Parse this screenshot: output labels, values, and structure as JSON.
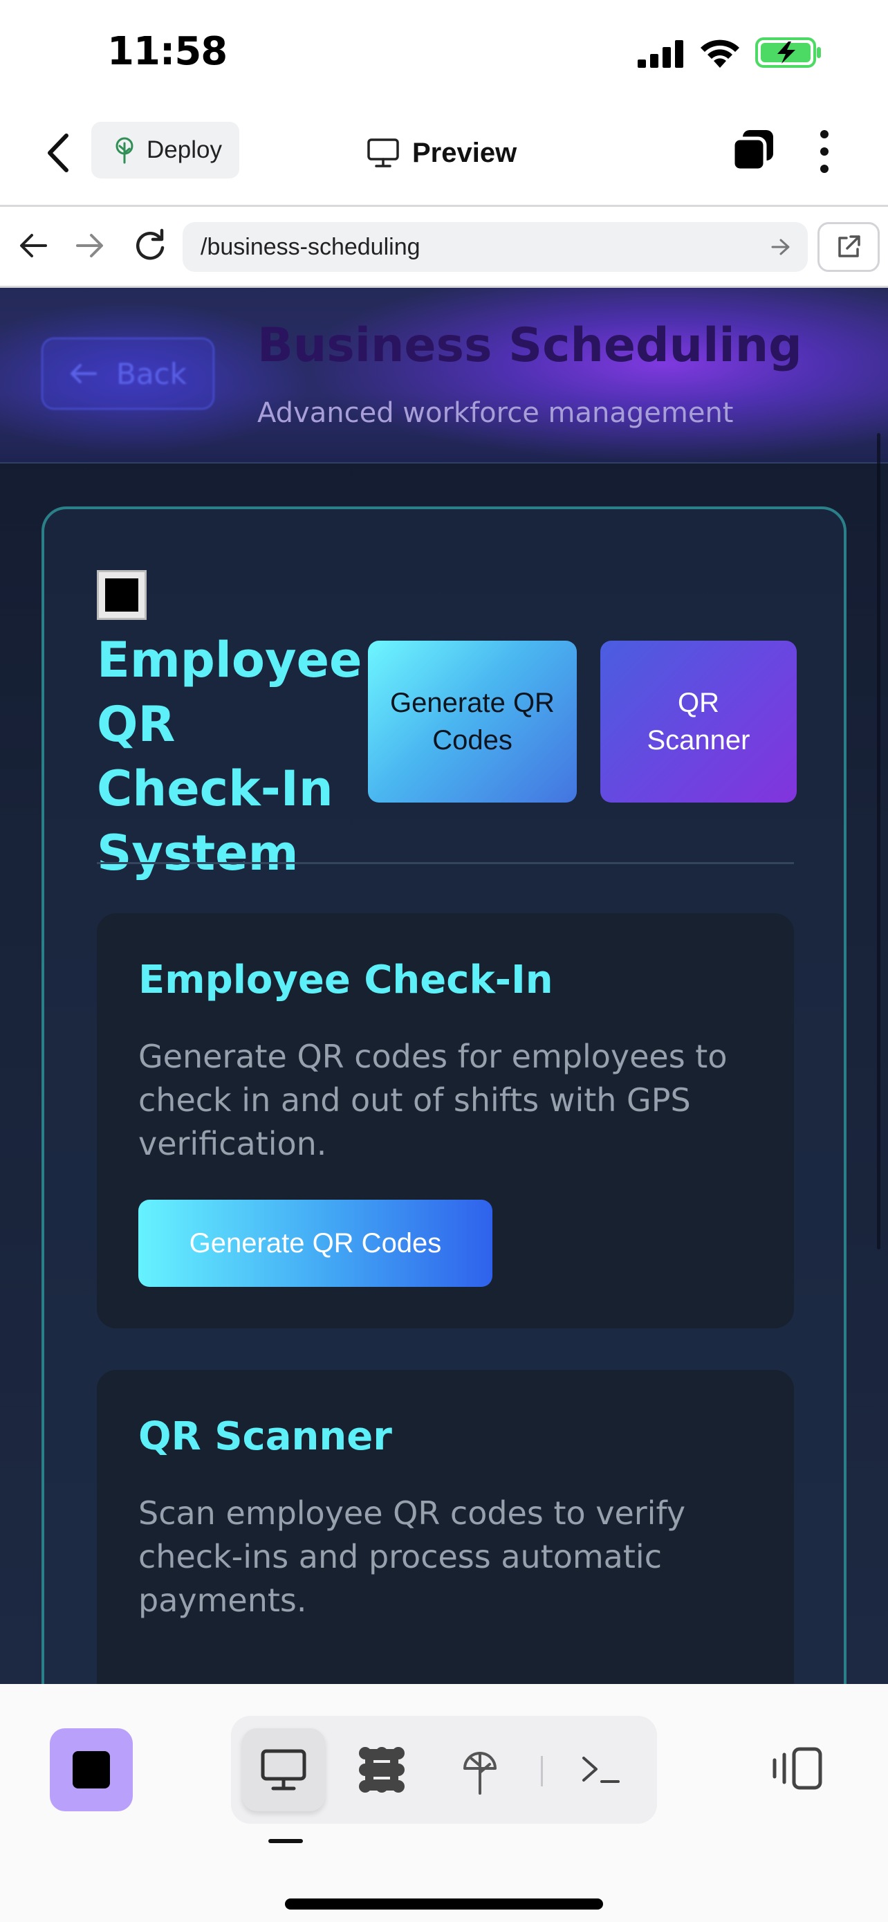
{
  "status_bar": {
    "time": "11:58"
  },
  "app_header": {
    "deploy_label": "Deploy",
    "title": "Preview"
  },
  "browser": {
    "url": "/business-scheduling"
  },
  "page": {
    "hero": {
      "back_label": "Back",
      "title": "Business Scheduling",
      "subtitle": "Advanced workforce management"
    },
    "card": {
      "title": "Employee QR Check-In System",
      "generate_button": "Generate QR Codes",
      "scanner_button": "QR Scanner",
      "features": [
        {
          "title": "Employee Check-In",
          "description": "Generate QR codes for employees to check in and out of shifts with GPS verification.",
          "button": "Generate QR Codes"
        },
        {
          "title": "QR Scanner",
          "description": "Scan employee QR codes to verify check-ins and process automatic payments."
        }
      ]
    }
  },
  "toolbar": {
    "items": [
      "desktop-preview",
      "apps",
      "deploy",
      "terminal"
    ],
    "active": "desktop-preview"
  },
  "colors": {
    "accent_cyan": "#5ef0f8",
    "accent_purple": "#8234dc",
    "stop_button": "#b9a0fb",
    "battery_green": "#4cd964"
  }
}
